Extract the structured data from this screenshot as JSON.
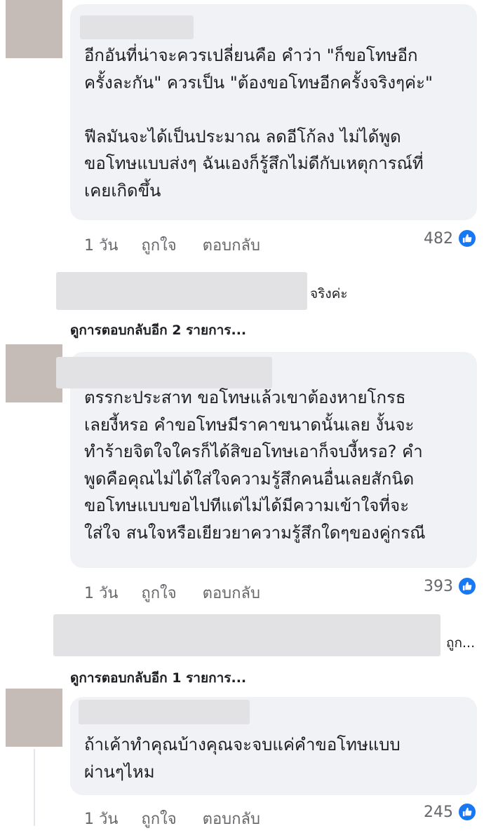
{
  "comments": [
    {
      "text_lines": [
        "อีกอันที่น่าจะควรเปลี่ยนคือ คำว่า \"ก็ขอโทษอีก",
        "ครั้งละกัน\" ควรเป็น \"ต้องขอโทษอีกครั้งจริงๆค่ะ\"",
        "",
        "ฟีลมันจะได้เป็นประมาณ ลดอีโก้ลง ไม่ได้พูด",
        "ขอโทษแบบส่งๆ ฉันเองก็รู้สึกไม่ดีกับเหตุการณ์ที่",
        "เคยเกิดขึ้น"
      ],
      "time": "1 วัน",
      "like_label": "ถูกใจ",
      "reply_label": "ตอบกลับ",
      "reaction_count": "482"
    },
    {
      "text_lines": [
        "ตรรกะประสาท ขอโทษแล้วเขาต้องหายโกรธ",
        "เลยงี้หรอ คำขอโทษมีราคาขนาดนั้นเลย งั้นจะ",
        "ทำร้ายจิตใจใครก็ได้สิขอโทษเอาก็จบงี้หรอ? คำ",
        "พูดคือคุณไม่ได้ใส่ใจความรู้สึกคนอื่นเลยสักนิด",
        "ขอโทษแบบขอไปทีแต่ไม่ได้มีความเข้าใจที่จะ",
        "ใส่ใจ สนใจหรือเยียวยาความรู้สึกใดๆของคู่กรณี"
      ],
      "time": "1 วัน",
      "like_label": "ถูกใจ",
      "reply_label": "ตอบกลับ",
      "reaction_count": "393"
    },
    {
      "text_lines": [
        "ถ้าเค้าทำคุณบ้างคุณจะจบแค่คำขอโทษแบบ",
        "ผ่านๆไหม"
      ],
      "time": "1 วัน",
      "like_label": "ถูกใจ",
      "reply_label": "ตอบกลับ",
      "reaction_count": "245"
    }
  ],
  "reply_snippets": [
    "จริงค่ะ",
    "ถูก..."
  ],
  "more_replies": [
    "ดูการตอบกลับอีก 2 รายการ...",
    "ดูการตอบกลับอีก 1 รายการ..."
  ],
  "icons": {
    "reaction": "like-icon"
  },
  "colors": {
    "like_blue": "#1877f2",
    "bubble": "#f0f2f5",
    "meta_text": "#65676b"
  }
}
